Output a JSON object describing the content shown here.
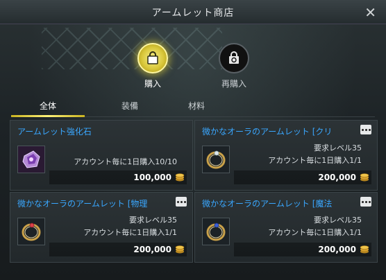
{
  "window": {
    "title": "アームレット商店",
    "close_icon": "close-icon"
  },
  "modes": [
    {
      "label": "購入",
      "icon": "shopping-bag-icon",
      "active": true
    },
    {
      "label": "再購入",
      "icon": "repurchase-bag-icon",
      "active": false
    }
  ],
  "tabs": [
    {
      "label": "全体",
      "active": true
    },
    {
      "label": "装備",
      "active": false
    },
    {
      "label": "材料",
      "active": false
    }
  ],
  "items": [
    {
      "name": "アームレット強化石",
      "requirement": "",
      "limit": "アカウント毎に1日購入10/10",
      "price": "100,000",
      "icon": "enhancement-stone-icon",
      "has_more": false
    },
    {
      "name": "微かなオーラのアームレット [クリ",
      "requirement": "要求レベル35",
      "limit": "アカウント毎に1日購入1/1",
      "price": "200,000",
      "icon": "bracelet-icon",
      "has_more": true
    },
    {
      "name": "微かなオーラのアームレット [物理",
      "requirement": "要求レベル35",
      "limit": "アカウント毎に1日購入1/1",
      "price": "200,000",
      "icon": "bracelet-icon",
      "has_more": true
    },
    {
      "name": "微かなオーラのアームレット [魔法",
      "requirement": "要求レベル35",
      "limit": "アカウント毎に1日購入1/1",
      "price": "200,000",
      "icon": "bracelet-icon",
      "has_more": true
    }
  ],
  "colors": {
    "accent": "#e6d53a",
    "item_name": "#3aa7ff",
    "coin": "#e3b23c"
  }
}
